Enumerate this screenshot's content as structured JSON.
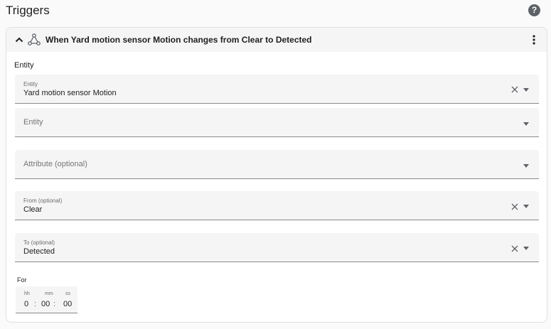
{
  "page": {
    "title": "Triggers"
  },
  "header": {
    "title": "When Yard motion sensor Motion changes from Clear to Detected"
  },
  "section": {
    "label": "Entity"
  },
  "fields": {
    "entity": {
      "label": "Entity",
      "value": "Yard motion sensor Motion"
    },
    "entity2": {
      "placeholder": "Entity"
    },
    "attribute": {
      "placeholder": "Attribute (optional)"
    },
    "from": {
      "label": "From (optional)",
      "value": "Clear"
    },
    "to": {
      "label": "To (optional)",
      "value": "Detected"
    }
  },
  "duration": {
    "label": "For",
    "hh_label": "hh",
    "hh": "0",
    "mm_label": "mm",
    "mm": "00",
    "ss_label": "ss",
    "ss": "00",
    "separator": ":"
  },
  "icons": {
    "help": "help-circle-icon",
    "collapse": "chevron-up-icon",
    "trigger": "state-trigger-icon",
    "menu": "more-vertical-icon",
    "clear": "close-icon",
    "dropdown": "caret-down-icon"
  }
}
